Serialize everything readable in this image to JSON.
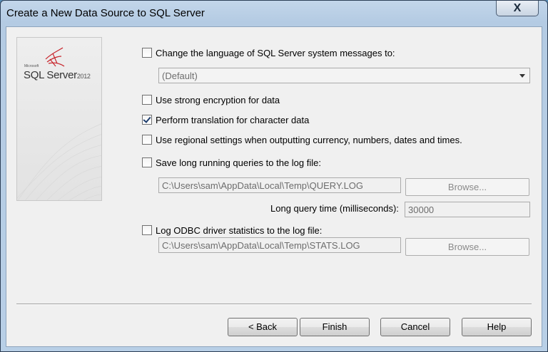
{
  "window": {
    "title": "Create a New Data Source to SQL Server",
    "close_glyph": "X"
  },
  "brand": {
    "small": "Microsoft",
    "name": "SQL Server",
    "version": "2012"
  },
  "options": {
    "language": {
      "label": "Change the language of SQL Server system messages to:",
      "checked": false,
      "select_value": "(Default)"
    },
    "strong_encryption": {
      "label": "Use strong encryption for data",
      "checked": false
    },
    "translation": {
      "label": "Perform translation for character data",
      "checked": true
    },
    "regional": {
      "label": "Use regional settings when outputting currency, numbers, dates and times.",
      "checked": false
    },
    "long_queries": {
      "label": "Save long running queries to the log file:",
      "checked": false,
      "path": "C:\\Users\\sam\\AppData\\Local\\Temp\\QUERY.LOG",
      "browse": "Browse...",
      "time_label": "Long query time (milliseconds):",
      "time_value": "30000"
    },
    "odbc_stats": {
      "label": "Log ODBC driver statistics to the log file:",
      "checked": false,
      "path": "C:\\Users\\sam\\AppData\\Local\\Temp\\STATS.LOG",
      "browse": "Browse..."
    }
  },
  "buttons": {
    "back": "< Back",
    "finish": "Finish",
    "cancel": "Cancel",
    "help": "Help"
  }
}
